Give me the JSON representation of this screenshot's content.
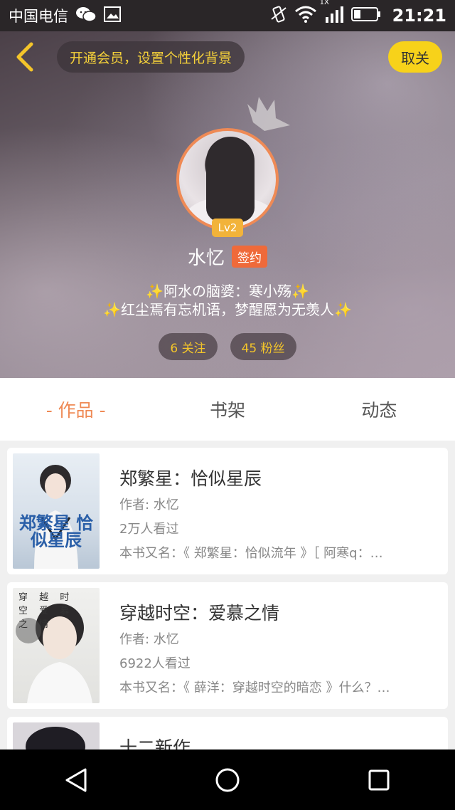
{
  "status_bar": {
    "carrier": "中国电信",
    "network_badge": "1X",
    "time": "21:21",
    "icons": [
      "wechat-icon",
      "image-icon",
      "vibrate-icon",
      "wifi-icon",
      "signal-icon",
      "battery-icon"
    ]
  },
  "header": {
    "vip_banner": "开通会员，设置个性化背景",
    "unfollow_label": "取关",
    "level": "Lv2",
    "username": "水忆",
    "signed_badge": "签约",
    "bio_line1": "阿水の脑婆：寒小殇",
    "bio_line2": "红尘焉有忘机语，梦醒愿为无羡人",
    "spark": "✨",
    "following": "6 关注",
    "followers": "45 粉丝"
  },
  "tabs": [
    {
      "label": "- 作品 -",
      "active": true
    },
    {
      "label": "书架",
      "active": false
    },
    {
      "label": "动态",
      "active": false
    }
  ],
  "books": [
    {
      "title": "郑繁星：恰似星辰",
      "author": "作者: 水忆",
      "views": "2万人看过",
      "alias": "本书又名：《 郑繁星：恰似流年 》［ 阿寒q：…",
      "cover_text": "郑繁星 恰似星辰"
    },
    {
      "title": "穿越时空：爱慕之情",
      "author": "作者: 水忆",
      "views": "6922人看过",
      "alias": "本书又名：《 薛洋：穿越时空的暗恋 》什么？…",
      "cover_text": "穿 越 时 空 爱 慕 之 情"
    },
    {
      "title": "十二新作"
    }
  ],
  "colors": {
    "accent": "#ef8a55",
    "gold": "#f4c52a",
    "unfollow_bg": "#f7d21a",
    "signed_bg": "#ef6a3a"
  }
}
